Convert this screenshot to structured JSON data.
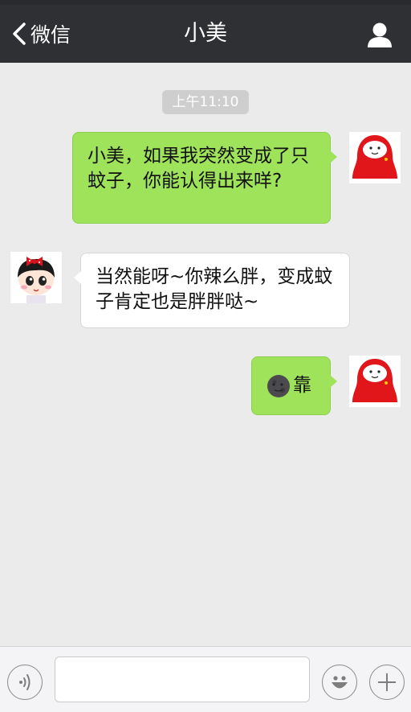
{
  "header": {
    "back_label": "微信",
    "title": "小美"
  },
  "timestamp": "上午11:10",
  "messages": [
    {
      "side": "out",
      "text": "小美，如果我突然变成了只蚊子，你能认得出来咩?"
    },
    {
      "side": "in",
      "text": "当然能呀~你辣么胖，变成蚊子肯定也是胖胖哒~"
    },
    {
      "side": "out",
      "emoji": "new-moon-face-icon",
      "text": "靠"
    }
  ],
  "input": {
    "value": "",
    "placeholder": ""
  },
  "colors": {
    "header_bg": "#2f3033",
    "chat_bg": "#ebebeb",
    "outgoing_bubble": "#9fe35b",
    "incoming_bubble": "#ffffff",
    "timestamp_bg": "#cecece"
  }
}
